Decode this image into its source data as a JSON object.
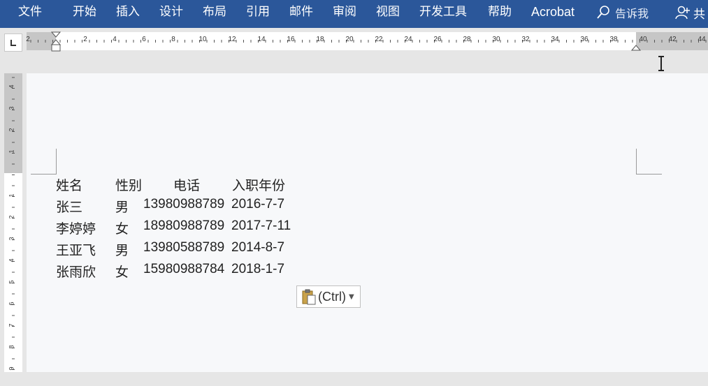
{
  "ribbon": {
    "tabs": [
      "文件",
      "开始",
      "插入",
      "设计",
      "布局",
      "引用",
      "邮件",
      "审阅",
      "视图",
      "开发工具",
      "帮助",
      "Acrobat"
    ],
    "tell_me": "告诉我",
    "share": "共"
  },
  "ruler": {
    "horizontal_labels": [
      "2",
      "2",
      "4",
      "6",
      "8",
      "10",
      "12",
      "14",
      "16",
      "18",
      "20",
      "22",
      "24",
      "26",
      "28",
      "30",
      "32",
      "34",
      "36",
      "38",
      "40",
      "42",
      "44"
    ],
    "vertical_labels_top": [
      "4",
      "3",
      "2",
      "1"
    ],
    "vertical_labels_body": [
      "1",
      "2",
      "3",
      "4",
      "5",
      "6",
      "7",
      "8",
      "9"
    ]
  },
  "document": {
    "header": [
      "姓名",
      "性别",
      "电话",
      "入职年份"
    ],
    "rows": [
      [
        "张三",
        "男",
        "13980988789",
        "2016-7-7"
      ],
      [
        "李婷婷",
        "女",
        "18980988789",
        "2017-7-11"
      ],
      [
        "王亚飞",
        "男",
        "13980588789",
        "2014-8-7"
      ],
      [
        "张雨欣",
        "女",
        "15980988784",
        "2018-1-7"
      ]
    ]
  },
  "paste_options": {
    "label": "(Ctrl)"
  },
  "colors": {
    "ribbon": "#2b579a",
    "page": "#f7f8fa",
    "workspace": "#e6e6e6"
  }
}
